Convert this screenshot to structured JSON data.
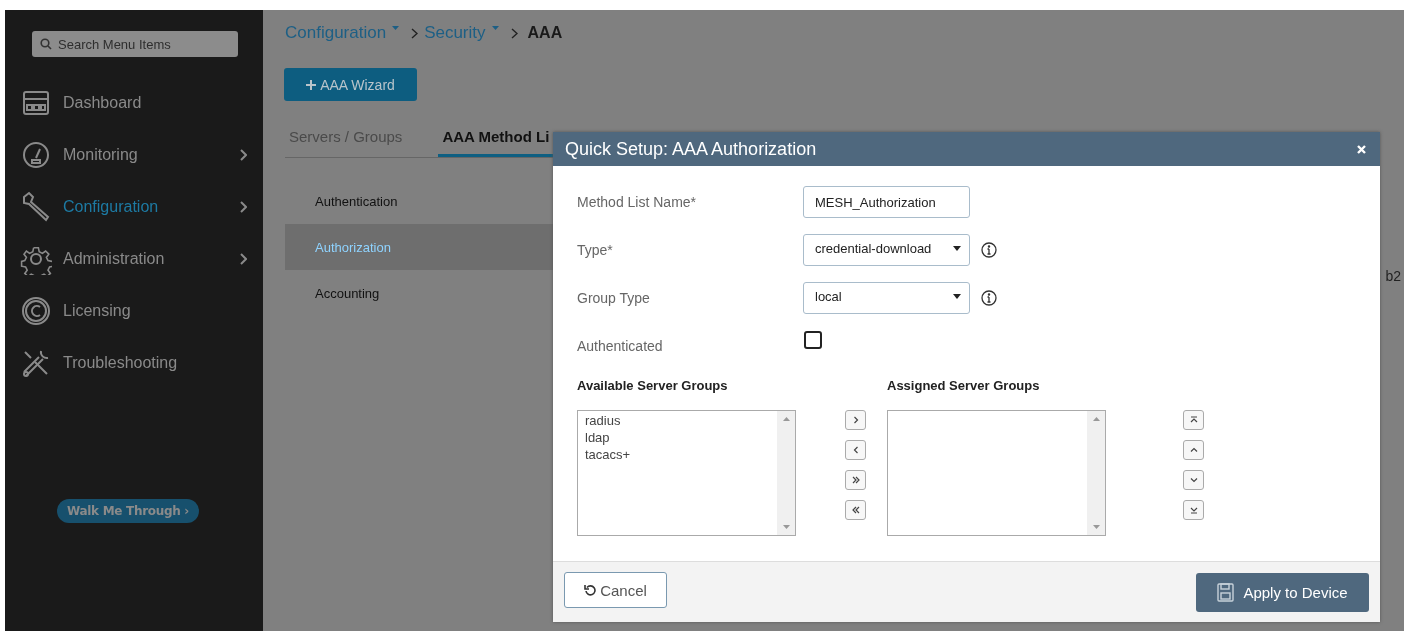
{
  "sidebar": {
    "search": {
      "placeholder": "Search Menu Items"
    },
    "items": [
      {
        "label": "Dashboard",
        "kind": "dashboard",
        "has_submenu": false,
        "selected": false
      },
      {
        "label": "Monitoring",
        "kind": "monitoring",
        "has_submenu": true,
        "selected": false
      },
      {
        "label": "Configuration",
        "kind": "configuration",
        "has_submenu": true,
        "selected": true
      },
      {
        "label": "Administration",
        "kind": "administration",
        "has_submenu": true,
        "selected": false
      },
      {
        "label": "Licensing",
        "kind": "licensing",
        "has_submenu": false,
        "selected": false
      },
      {
        "label": "Troubleshooting",
        "kind": "troubleshooting",
        "has_submenu": false,
        "selected": false
      }
    ],
    "walk_button": "Walk Me Through ›"
  },
  "breadcrumb": [
    {
      "label": "Configuration",
      "kind": "dropdown"
    },
    {
      "label": "Security",
      "kind": "dropdown"
    },
    {
      "label": "AAA",
      "kind": "current"
    }
  ],
  "wizard_button": "AAA Wizard",
  "tabs": [
    {
      "label": "Servers / Groups",
      "selected": false
    },
    {
      "label": "AAA Method Li",
      "selected": true
    }
  ],
  "method_types": [
    {
      "label": "Authentication",
      "selected": false
    },
    {
      "label": "Authorization",
      "selected": true
    },
    {
      "label": "Accounting",
      "selected": false
    }
  ],
  "column_3_fragment": "b2",
  "dialog": {
    "title": "Quick Setup: AAA Authorization",
    "fields": [
      {
        "kind": "text",
        "label": "Method List Name*",
        "value": "MESH_Authorization",
        "info": false
      },
      {
        "kind": "select",
        "label": "Type*",
        "value": "credential-download",
        "info": true
      },
      {
        "kind": "select",
        "label": "Group Type",
        "value": "local",
        "info": true
      },
      {
        "kind": "checkbox",
        "label": "Authenticated",
        "checked": false
      }
    ],
    "available": {
      "title": "Available Server Groups",
      "items": [
        "radius",
        "ldap",
        "tacacs+"
      ]
    },
    "assigned": {
      "title": "Assigned Server Groups"
    },
    "cancel_button": "Cancel",
    "apply_button": "Apply to Device"
  }
}
